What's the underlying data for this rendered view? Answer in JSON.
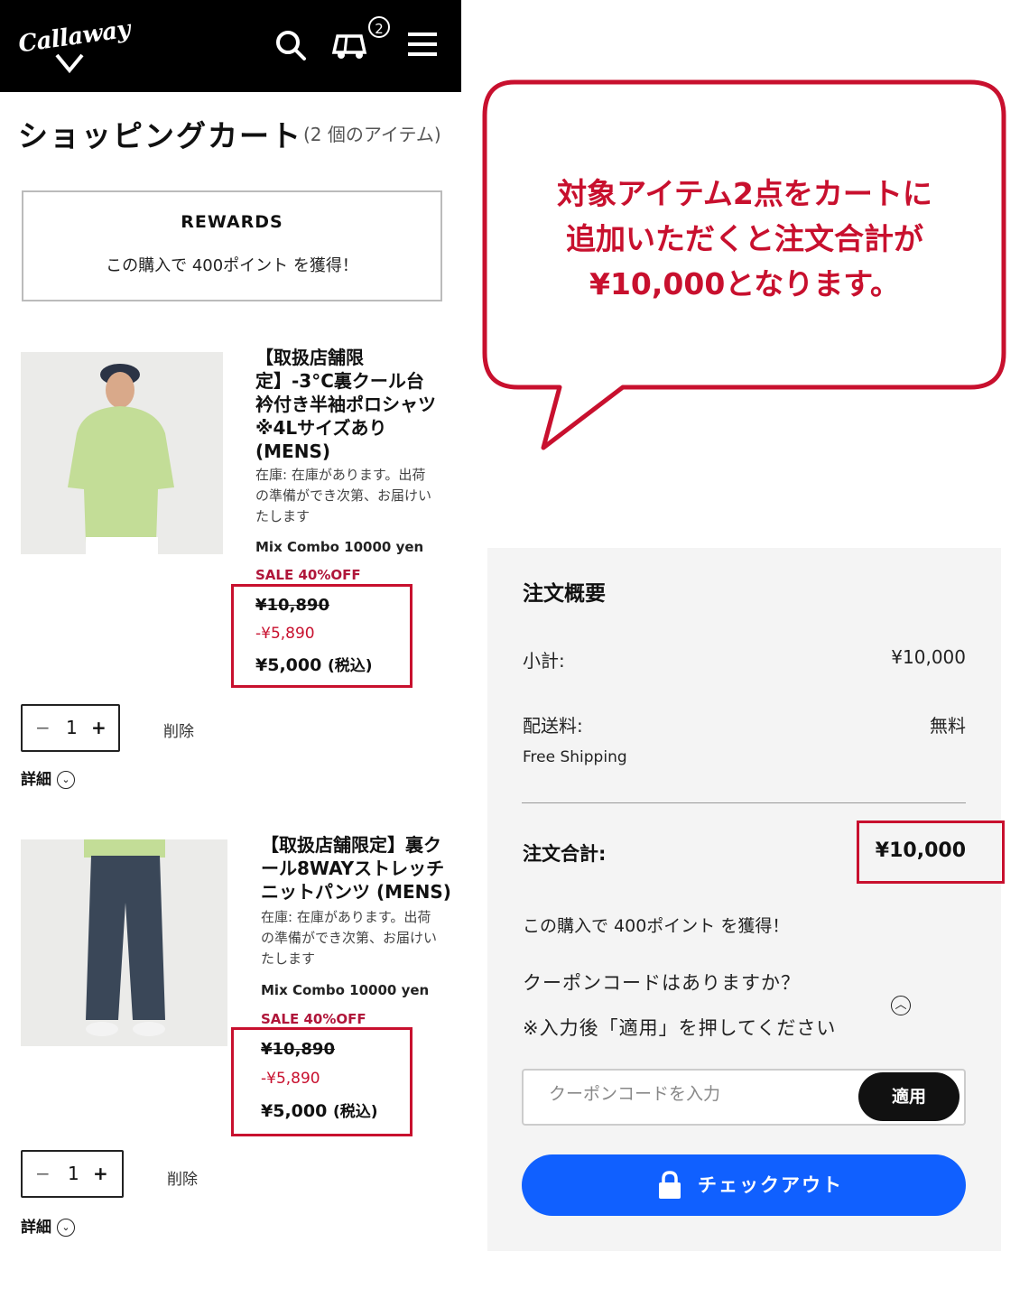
{
  "header": {
    "brand": "Callaway",
    "cart_count": "2",
    "icons": [
      "search-icon",
      "golf-cart-icon",
      "menu-icon"
    ]
  },
  "cart": {
    "title": "ショッピングカート",
    "item_count": "(2 個のアイテム)"
  },
  "rewards": {
    "heading": "REWARDS",
    "text": "この購入で 400ポイント を獲得！"
  },
  "items": [
    {
      "name_lines": [
        "【取扱店舗限",
        "定】-3°C裏クール台",
        "衿付き半袖ポロシャツ",
        "※4Lサイズあり",
        "(MENS)"
      ],
      "stock_lines": [
        "在庫: 在庫があります。出荷",
        "の準備ができ次第、お届けい",
        "たします"
      ],
      "combo": "Mix Combo 10000 yen",
      "sale": "SALE 40%OFF",
      "original_price": "¥10,890",
      "discount": "-¥5,890",
      "final_price": "¥5,000",
      "tax_label": "(税込)",
      "quantity": "1",
      "delete_label": "削除",
      "detail_label": "詳細"
    },
    {
      "name_lines": [
        "【取扱店舗限定】裏ク",
        "ール8WAYストレッチ",
        "ニットパンツ (MENS)"
      ],
      "stock_lines": [
        "在庫: 在庫があります。出荷",
        "の準備ができ次第、お届けい",
        "たします"
      ],
      "combo": "Mix Combo 10000 yen",
      "sale": "SALE 40%OFF",
      "original_price": "¥10,890",
      "discount": "-¥5,890",
      "final_price": "¥5,000",
      "tax_label": "(税込)",
      "quantity": "1",
      "delete_label": "削除",
      "detail_label": "詳細"
    }
  ],
  "callout": {
    "lines": [
      "対象アイテム2点をカートに",
      "追加いただくと注文合計が",
      "¥10,000となります。"
    ]
  },
  "summary": {
    "title": "注文概要",
    "subtotal_label": "小計:",
    "subtotal_value": "¥10,000",
    "shipping_label": "配送料:",
    "shipping_value": "無料",
    "shipping_note": "Free Shipping",
    "total_label": "注文合計:",
    "total_value": "¥10,000",
    "points_text": "この購入で 400ポイント を獲得！",
    "coupon_question": "クーポンコードはありますか？",
    "coupon_note": "※入力後「適用」を押してください",
    "coupon_placeholder": "クーポンコードを入力",
    "apply_label": "適用",
    "checkout_label": "チェックアウト"
  },
  "colors": {
    "accent_red": "#c8102e",
    "checkout_blue": "#1060ff",
    "header_black": "#000000"
  }
}
